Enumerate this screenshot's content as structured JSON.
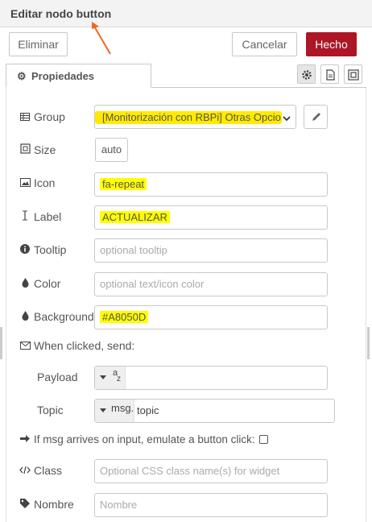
{
  "header": {
    "title": "Editar nodo button"
  },
  "toolbar": {
    "delete_label": "Eliminar",
    "cancel_label": "Cancelar",
    "done_label": "Hecho"
  },
  "tabs": [
    {
      "label": "Propiedades",
      "icon": "gear-icon"
    }
  ],
  "tab_tools": [
    "gear-icon",
    "description-icon",
    "appearance-icon"
  ],
  "form": {
    "group": {
      "label": "Group",
      "icon": "table-icon",
      "value": "[Monitorización con RBPi] Otras Opciones"
    },
    "size": {
      "label": "Size",
      "icon": "resize-icon",
      "value": "auto"
    },
    "icon": {
      "label": "Icon",
      "icon": "picture-icon",
      "value": "fa-repeat"
    },
    "label": {
      "label": "Label",
      "icon": "text-cursor-icon",
      "value": "ACTUALIZAR"
    },
    "tooltip": {
      "label": "Tooltip",
      "icon": "info-icon",
      "placeholder": "optional tooltip"
    },
    "color": {
      "label": "Color",
      "icon": "tint-icon",
      "placeholder": "optional text/icon color"
    },
    "background": {
      "label": "Background",
      "icon": "tint-icon",
      "value": "#A8050D"
    },
    "when_clicked": {
      "label": "When clicked, send:",
      "icon": "envelope-icon"
    },
    "payload": {
      "label": "Payload",
      "type_label": "a",
      "type_sub": "z",
      "value": ""
    },
    "topic": {
      "label": "Topic",
      "type_label": "msg.",
      "value": "topic"
    },
    "emulate": {
      "label": "If msg arrives on input, emulate a button click:",
      "icon": "arrow-right-icon",
      "checked": false
    },
    "class": {
      "label": "Class",
      "icon": "code-icon",
      "placeholder": "Optional CSS class name(s) for widget"
    },
    "name": {
      "label": "Nombre",
      "icon": "tag-icon",
      "placeholder": "Nombre"
    }
  },
  "colors": {
    "accent_red": "#ad1625",
    "highlight": "#ffff00",
    "annotation_arrow": "#f26522"
  }
}
